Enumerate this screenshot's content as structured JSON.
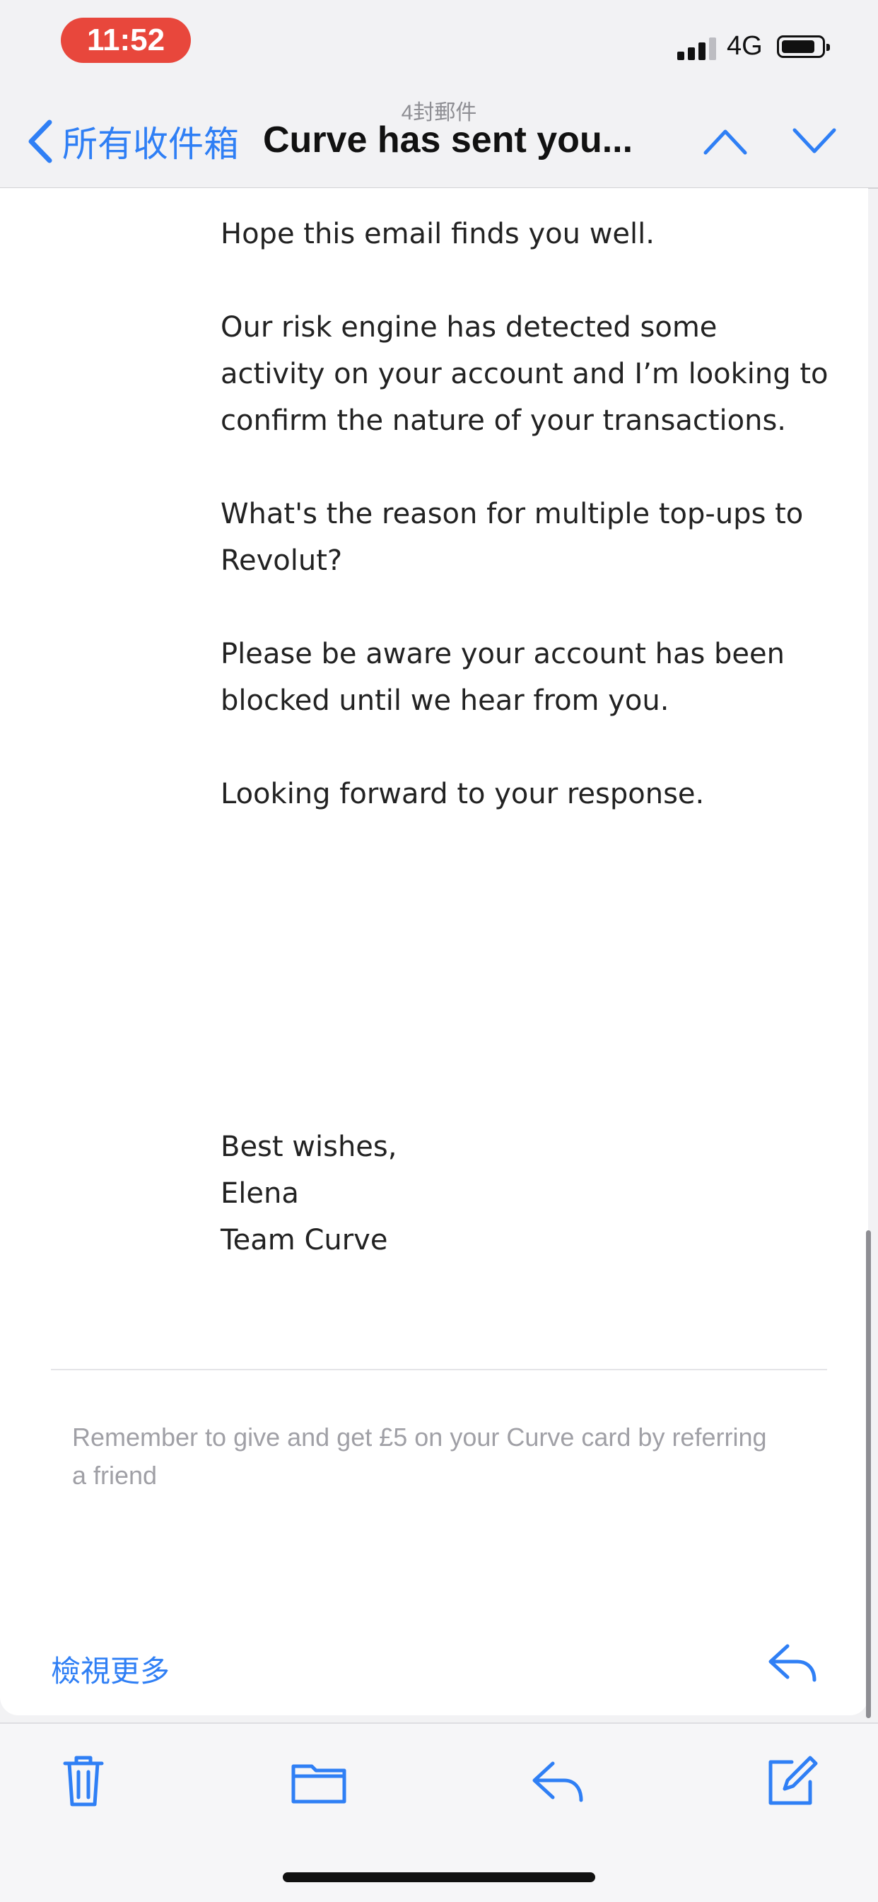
{
  "status": {
    "time": "11:52",
    "network": "4G",
    "signal_bars_active": 3,
    "signal_bars_total": 4
  },
  "nav": {
    "message_count": "4封郵件",
    "back_label": "所有收件箱",
    "title": "Curve has sent you...",
    "icons": [
      "chevron-left-icon",
      "chevron-up-icon",
      "chevron-down-icon"
    ]
  },
  "email": {
    "paragraphs": [
      "Hope this email finds you well.",
      "Our risk engine has detected some activity on your account and I’m looking to confirm the nature of your transactions.",
      "What's the reason for multiple top-ups to Revolut?",
      "Please be aware your account has been blocked until we hear from you.",
      "Looking forward to your response."
    ],
    "signoff": [
      "Best wishes,",
      "Elena",
      "Team Curve"
    ],
    "footer_note": "Remember to give and get £5 on your Curve card by referring a friend",
    "view_more": "檢視更多"
  },
  "toolbar": {
    "icons": [
      "trash-icon",
      "folder-icon",
      "reply-icon",
      "compose-icon"
    ]
  },
  "colors": {
    "accent": "#2f7ff5",
    "time_pill": "#e8473c",
    "muted_text": "#a0a0a6"
  }
}
